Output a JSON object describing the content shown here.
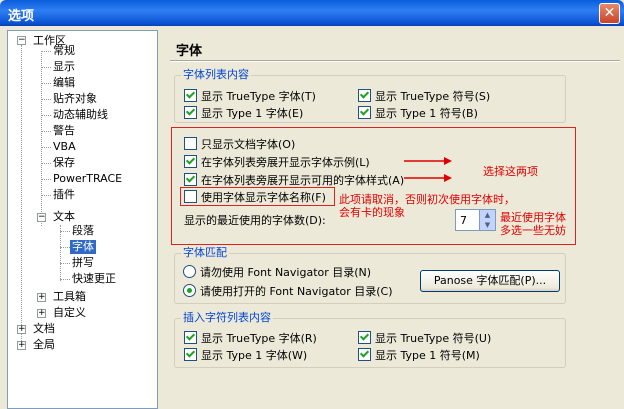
{
  "window": {
    "title": "选项",
    "close_label": "✕"
  },
  "tree": {
    "workspace": "工作区",
    "items": [
      "常规",
      "显示",
      "编辑",
      "贴齐对象",
      "动态辅助线",
      "警告",
      "VBA",
      "保存",
      "PowerTRACE",
      "插件"
    ],
    "text": "文本",
    "text_children": [
      "段落",
      "字体",
      "拼写",
      "快速更正"
    ],
    "toolbox": "工具箱",
    "custom": "自定义",
    "document": "文档",
    "global": "全局"
  },
  "panel": {
    "heading": "字体",
    "font_list": {
      "legend": "字体列表内容",
      "show_tt_font": "显示 TrueType 字体(T)",
      "show_tt_symbol": "显示 TrueType 符号(S)",
      "show_t1_font": "显示 Type 1 字体(E)",
      "show_t1_symbol": "显示 Type 1 符号(B)"
    },
    "only_doc_fonts": "只显示文档字体(O)",
    "show_sample": "在字体列表旁展开显示字体示例(L)",
    "show_styles": "在字体列表旁展开显示可用的字体样式(A)",
    "use_font_name": "使用字体显示字体名称(F)",
    "recent_label": "显示的最近使用的字体数(D):",
    "recent_value": "7",
    "font_match": {
      "legend": "字体匹配",
      "radio_no": "请勿使用 Font Navigator 目录(N)",
      "radio_yes": "请使用打开的 Font Navigator 目录(C)",
      "panose_button": "Panose 字体匹配(P)..."
    },
    "insert_list": {
      "legend": "插入字符列表内容",
      "show_tt_font": "显示 TrueType 字体(R)",
      "show_tt_symbol": "显示 TrueType 符号(U)",
      "show_t1_font": "显示 Type 1 字体(W)",
      "show_t1_symbol": "显示 Type 1 符号(M)"
    }
  },
  "annotations": {
    "choose_two": "选择这两项",
    "cancel_note_line1": "此项请取消，否则初次使用字体时，",
    "cancel_note_line2": "会有卡的现象",
    "recent_note_line1": "最近使用字体",
    "recent_note_line2": "多选一些无妨"
  },
  "colors": {
    "accent": "#0046d5",
    "annotation": "#e00000",
    "selection": "#316ac5"
  }
}
